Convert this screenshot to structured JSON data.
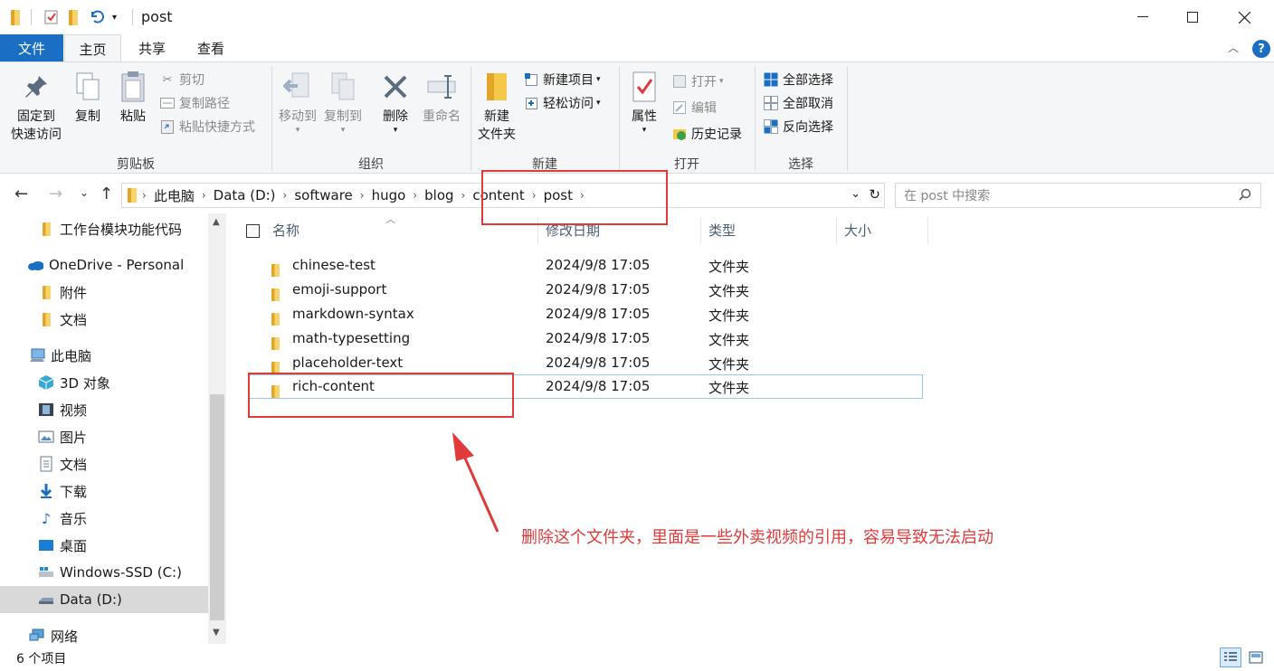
{
  "title": "post",
  "ribbon_tabs": [
    "文件",
    "主页",
    "共享",
    "查看"
  ],
  "ribbon": {
    "clipboard": {
      "pin_line1": "固定到",
      "pin_line2": "快速访问",
      "copy": "复制",
      "paste": "粘贴",
      "cut": "剪切",
      "copy_path": "复制路径",
      "paste_shortcut": "粘贴快捷方式",
      "label": "剪贴板"
    },
    "organize": {
      "move_to": "移动到",
      "copy_to": "复制到",
      "delete": "删除",
      "rename": "重命名",
      "label": "组织"
    },
    "new": {
      "new_folder_line1": "新建",
      "new_folder_line2": "文件夹",
      "new_item": "新建项目",
      "easy_access": "轻松访问",
      "label": "新建"
    },
    "open": {
      "properties": "属性",
      "open": "打开",
      "edit": "编辑",
      "history": "历史记录",
      "label": "打开"
    },
    "select": {
      "select_all": "全部选择",
      "select_none": "全部取消",
      "invert": "反向选择",
      "label": "选择"
    }
  },
  "breadcrumb": [
    "此电脑",
    "Data (D:)",
    "software",
    "hugo",
    "blog",
    "content",
    "post"
  ],
  "search": {
    "placeholder": "在 post 中搜索"
  },
  "sidebar": {
    "items": [
      {
        "label": "工作台模块功能代码",
        "icon": "folder-icon"
      },
      {
        "label": "OneDrive - Personal",
        "icon": "onedrive-icon"
      },
      {
        "label": "附件",
        "icon": "folder-icon"
      },
      {
        "label": "文档",
        "icon": "folder-icon"
      },
      {
        "label": "此电脑",
        "icon": "computer-icon"
      },
      {
        "label": "3D 对象",
        "icon": "3d-objects-icon"
      },
      {
        "label": "视频",
        "icon": "video-icon"
      },
      {
        "label": "图片",
        "icon": "pictures-icon"
      },
      {
        "label": "文档",
        "icon": "documents-icon"
      },
      {
        "label": "下载",
        "icon": "download-icon"
      },
      {
        "label": "音乐",
        "icon": "music-icon"
      },
      {
        "label": "桌面",
        "icon": "desktop-icon"
      },
      {
        "label": "Windows-SSD (C:)",
        "icon": "drive-c-icon"
      },
      {
        "label": "Data (D:)",
        "icon": "drive-d-icon"
      },
      {
        "label": "网络",
        "icon": "network-icon"
      }
    ]
  },
  "columns": [
    "名称",
    "修改日期",
    "类型",
    "大小"
  ],
  "files": [
    {
      "name": "chinese-test",
      "date": "2024/9/8 17:05",
      "type": "文件夹"
    },
    {
      "name": "emoji-support",
      "date": "2024/9/8 17:05",
      "type": "文件夹"
    },
    {
      "name": "markdown-syntax",
      "date": "2024/9/8 17:05",
      "type": "文件夹"
    },
    {
      "name": "math-typesetting",
      "date": "2024/9/8 17:05",
      "type": "文件夹"
    },
    {
      "name": "placeholder-text",
      "date": "2024/9/8 17:05",
      "type": "文件夹"
    },
    {
      "name": "rich-content",
      "date": "2024/9/8 17:05",
      "type": "文件夹"
    }
  ],
  "annotation": "删除这个文件夹，里面是一些外卖视频的引用，容易导致无法启动",
  "status": "6 个项目",
  "colors": {
    "accent": "#1a6fc4",
    "annotation": "#e03a3a",
    "folder": "#f3c74a"
  }
}
